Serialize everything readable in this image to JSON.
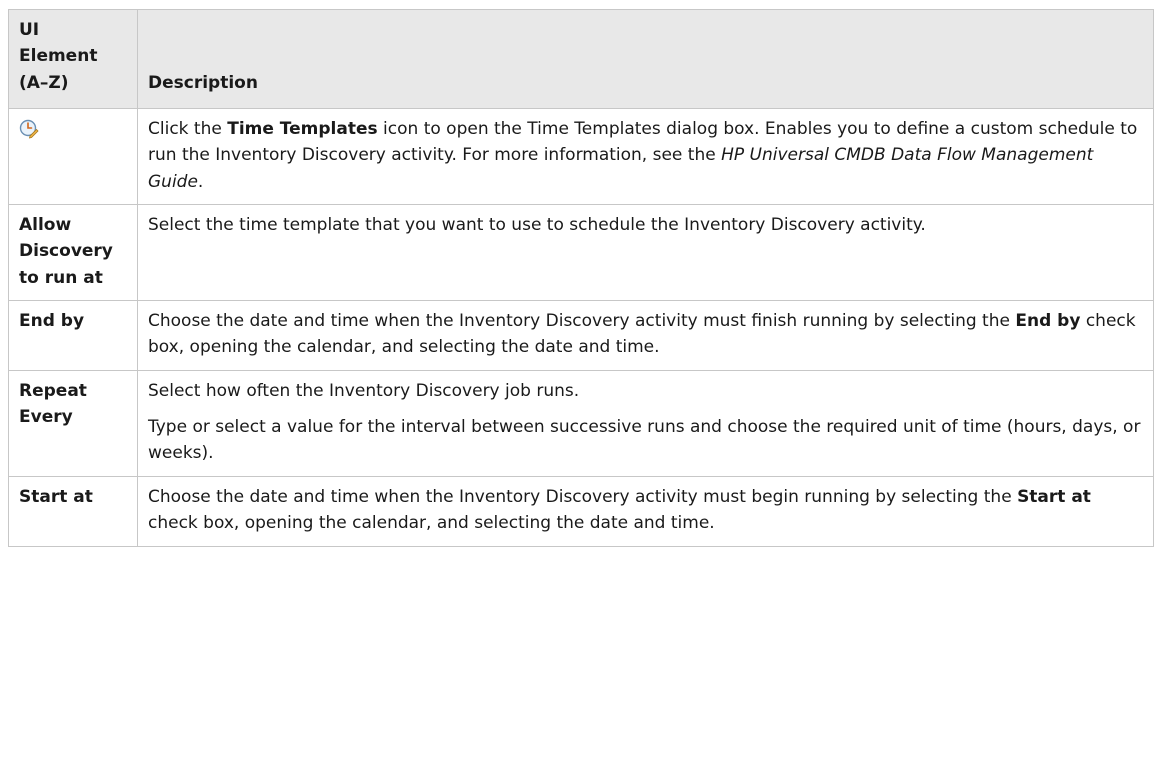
{
  "table": {
    "header": {
      "col1_line1": "UI",
      "col1_line2": "Element",
      "col1_line3": "(A–Z)",
      "col2": "Description"
    },
    "rows": [
      {
        "element_icon": "time-templates-icon",
        "desc": {
          "a": "Click the ",
          "b": "Time Templates",
          "c": " icon to open the Time Templates dialog box. Enables you to define a custom schedule to run the Inventory Discovery activity. For more information, see the ",
          "d": "HP Universal CMDB Data Flow Management Guide",
          "e": "."
        }
      },
      {
        "element_line1": "Allow",
        "element_line2": "Discovery",
        "element_line3": "to run at",
        "desc": "Select the time template that you want to use to schedule the Inventory Discovery activity."
      },
      {
        "element": "End by",
        "desc": {
          "a": "Choose the date and time when the Inventory Discovery activity must finish running by selecting the ",
          "b": "End by",
          "c": " check box, opening the calendar, and selecting the date and time."
        }
      },
      {
        "element_line1": "Repeat",
        "element_line2": "Every",
        "desc_p1": "Select how often the Inventory Discovery job runs.",
        "desc_p2": "Type or select a value for the interval between successive runs and choose the required unit of time (hours, days, or weeks)."
      },
      {
        "element": "Start at",
        "desc": {
          "a": "Choose the date and time when the Inventory Discovery activity must begin running by selecting the ",
          "b": "Start at",
          "c": " check box, opening the calendar, and selecting the date and time."
        }
      }
    ]
  }
}
